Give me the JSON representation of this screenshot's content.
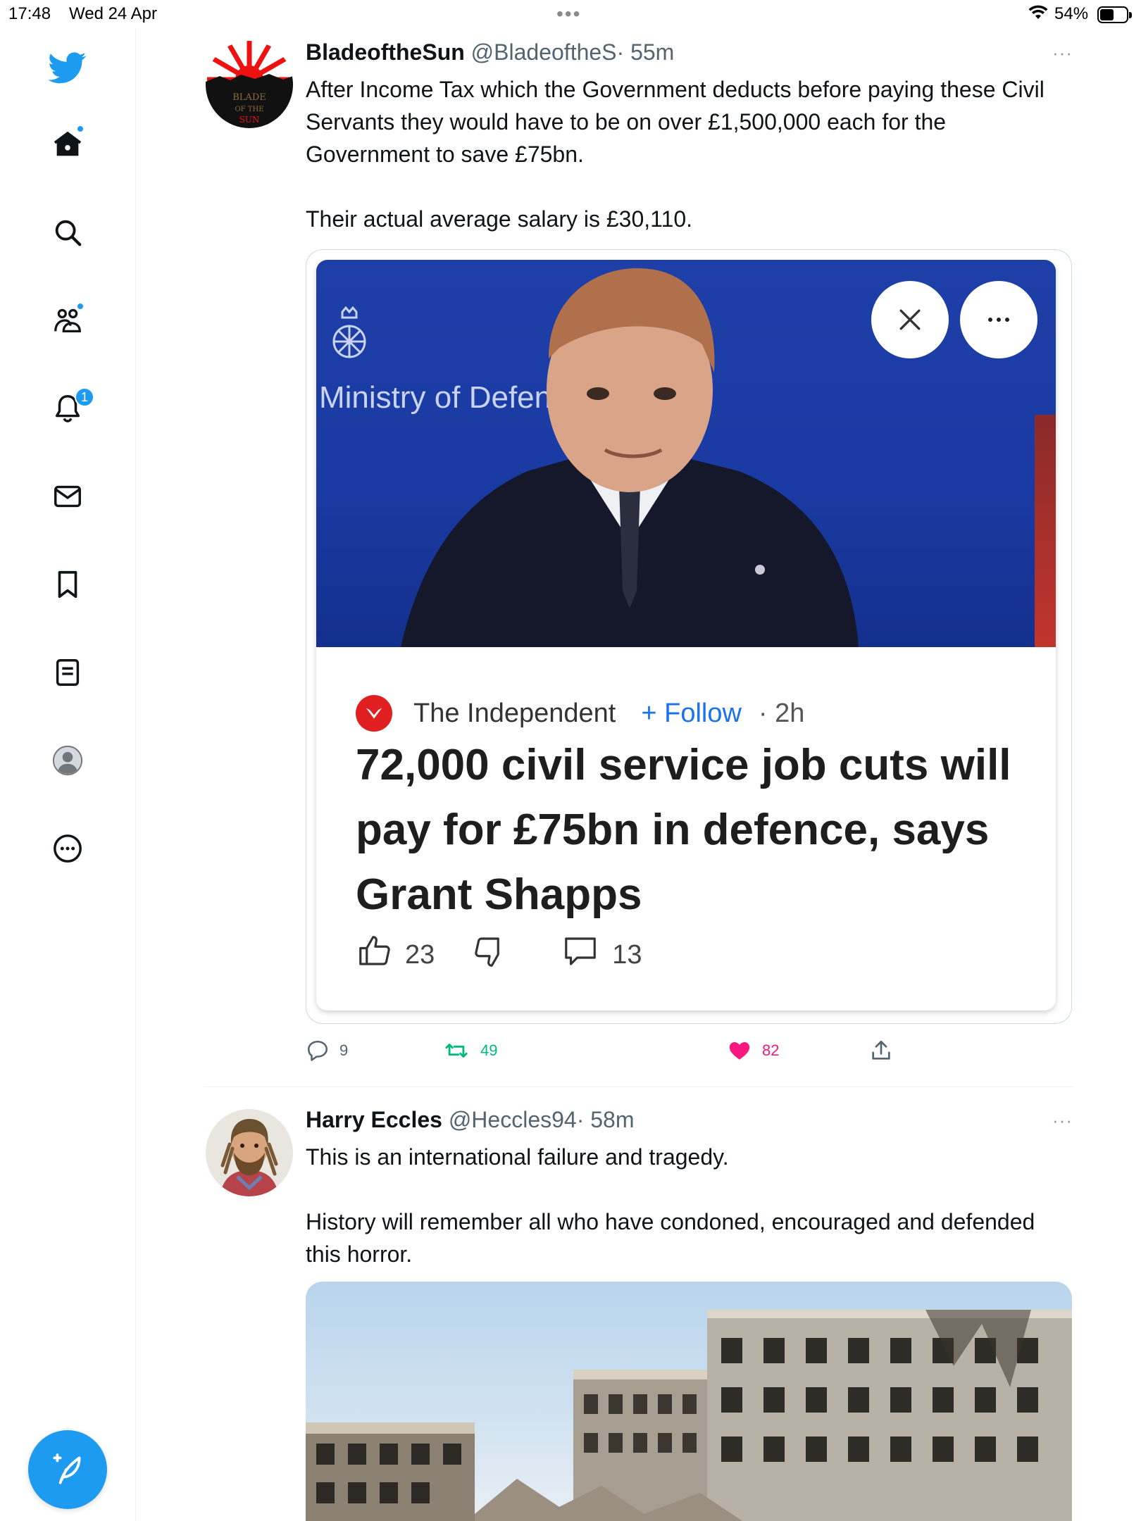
{
  "status_bar": {
    "time": "17:48",
    "date": "Wed 24 Apr",
    "battery": "54%",
    "battery_level": 0.54
  },
  "sidebar": {
    "items": [
      {
        "name": "twitter-logo"
      },
      {
        "name": "home",
        "has_dot": true
      },
      {
        "name": "explore"
      },
      {
        "name": "communities",
        "has_dot": true
      },
      {
        "name": "notifications",
        "badge": "1"
      },
      {
        "name": "messages"
      },
      {
        "name": "bookmarks"
      },
      {
        "name": "lists"
      },
      {
        "name": "profile"
      },
      {
        "name": "more"
      }
    ],
    "compose": "compose-tweet"
  },
  "tweets": [
    {
      "name": "BladeoftheSun",
      "handle": "@BladeoftheS",
      "time": "· 55m",
      "more": "···",
      "avatar_text": "BLADE OF THE SUN",
      "text": [
        "After Income Tax which the Government deducts before paying these Civil Servants they would have to be on over £1,500,000 each for the Government to save £75bn.",
        "Their actual average salary is £30,110."
      ],
      "card": {
        "image_text": "Ministry of Defence",
        "source": "The Independent",
        "follow": "+ Follow",
        "age": "· 2h",
        "headline": "72,000 civil service job cuts will pay for £75bn in defence, says Grant Shapps",
        "likes": "23",
        "comments": "13"
      },
      "actions": {
        "replies": "9",
        "retweets": "49",
        "likes": "82"
      }
    },
    {
      "name": "Harry Eccles",
      "handle": "@Heccles94",
      "time": "· 58m",
      "more": "···",
      "text": [
        "This is an international failure and tragedy.",
        "History will remember all who have condoned, encouraged and defended this horror."
      ]
    }
  ],
  "colors": {
    "accent": "#1d9bf0",
    "retweet": "#00ba7c",
    "like": "#f91880",
    "follow": "#1a73e8"
  }
}
